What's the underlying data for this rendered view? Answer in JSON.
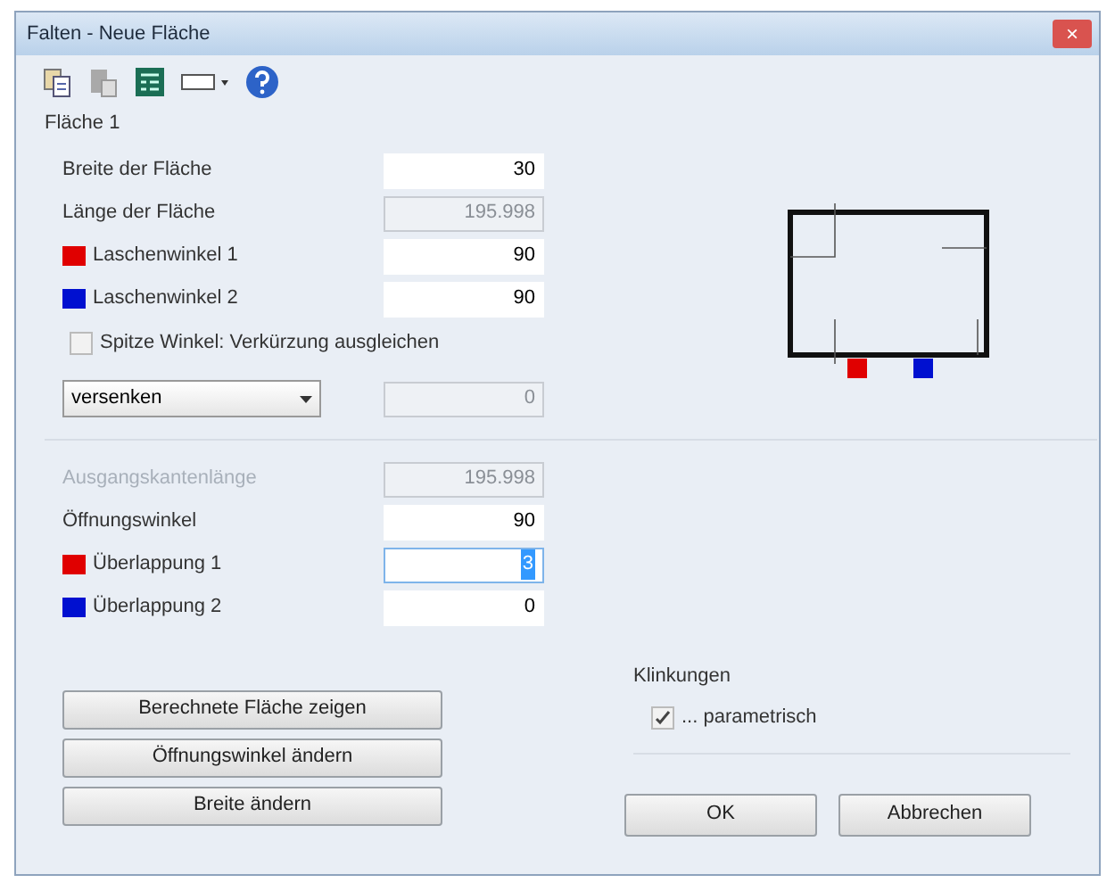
{
  "window": {
    "title": "Falten - Neue Fläche",
    "close": "×"
  },
  "section": {
    "title": "Fläche 1"
  },
  "fields_top": [
    {
      "label": "Breite der Fläche",
      "value": "30",
      "disabled": false
    },
    {
      "label": "Länge der Fläche",
      "value": "195.998",
      "disabled": true
    },
    {
      "label": "Laschenwinkel 1",
      "value": "90",
      "disabled": false,
      "color": "#e00000"
    },
    {
      "label": "Laschenwinkel 2",
      "value": "90",
      "disabled": false,
      "color": "#0010d0"
    }
  ],
  "acute_checkbox": {
    "label": "Spitze Winkel: Verkürzung ausgleichen",
    "checked": false
  },
  "mode_select": {
    "value": "versenken"
  },
  "mode_value": {
    "value": "0",
    "disabled": true
  },
  "fields_bottom": [
    {
      "label": "Ausgangskantenlänge",
      "label_disabled": true,
      "value": "195.998",
      "disabled": true
    },
    {
      "label": "Öffnungswinkel",
      "value": "90",
      "disabled": false
    },
    {
      "label": "Überlappung 1",
      "value": "3",
      "disabled": false,
      "focused": true,
      "color": "#e00000"
    },
    {
      "label": "Überlappung 2",
      "value": "0",
      "disabled": false,
      "color": "#0010d0"
    }
  ],
  "buttons": [
    "Berechnete Fläche zeigen",
    "Öffnungswinkel ändern",
    "Breite ändern"
  ],
  "klinkungen": {
    "title": "Klinkungen",
    "checkbox": {
      "label": "... parametrisch",
      "checked": true
    }
  },
  "dialog_buttons": [
    "OK",
    "Abbrechen"
  ]
}
